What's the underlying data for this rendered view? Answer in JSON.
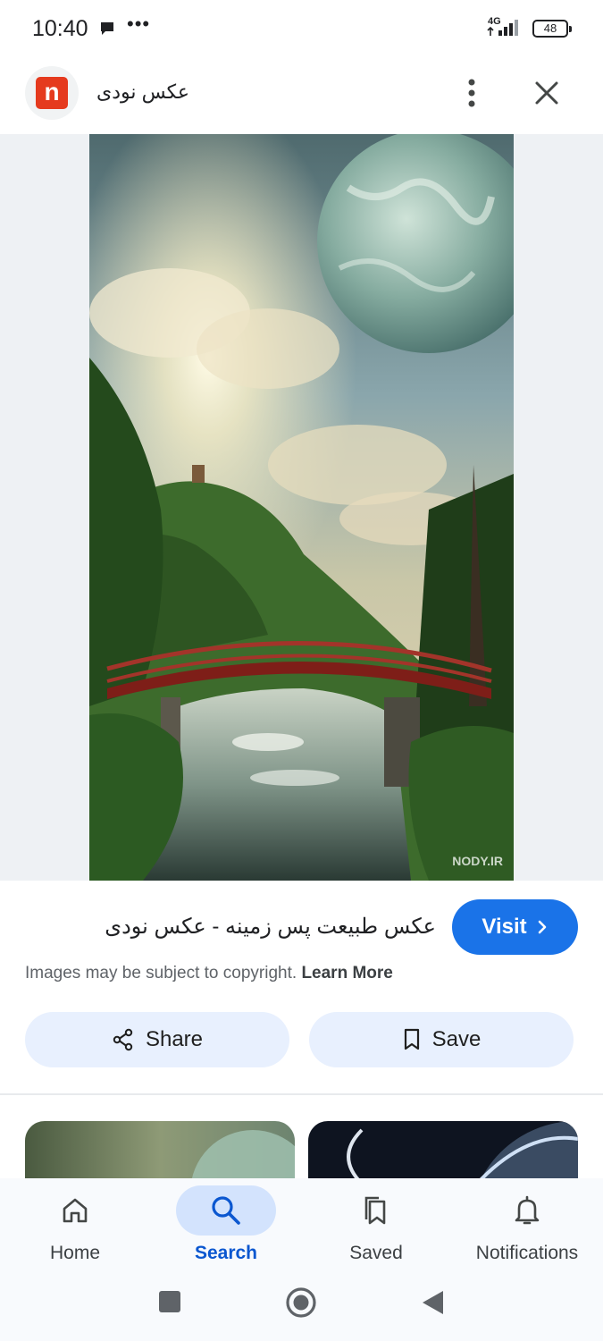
{
  "status_bar": {
    "time": "10:40",
    "dots": "•••",
    "network": "4G",
    "battery": "48"
  },
  "header": {
    "logo_letter": "n",
    "site_name": "عکس نودی"
  },
  "image": {
    "watermark": "NODY.IR"
  },
  "info": {
    "title": "عکس طبیعت پس زمینه - عکس نودی",
    "visit_label": "Visit",
    "copyright_text": "Images may be subject to copyright.",
    "learn_more": "Learn More",
    "share_label": "Share",
    "save_label": "Save"
  },
  "bottom_nav": {
    "items": [
      {
        "label": "Home",
        "icon": "home-icon"
      },
      {
        "label": "Search",
        "icon": "search-icon",
        "active": true
      },
      {
        "label": "Saved",
        "icon": "saved-icon"
      },
      {
        "label": "Notifications",
        "icon": "bell-icon"
      }
    ]
  },
  "colors": {
    "accent": "#1a73e8",
    "button_bg": "#e8f0fe",
    "active_nav": "#d3e3fd",
    "logo_red": "#e53a1e"
  }
}
